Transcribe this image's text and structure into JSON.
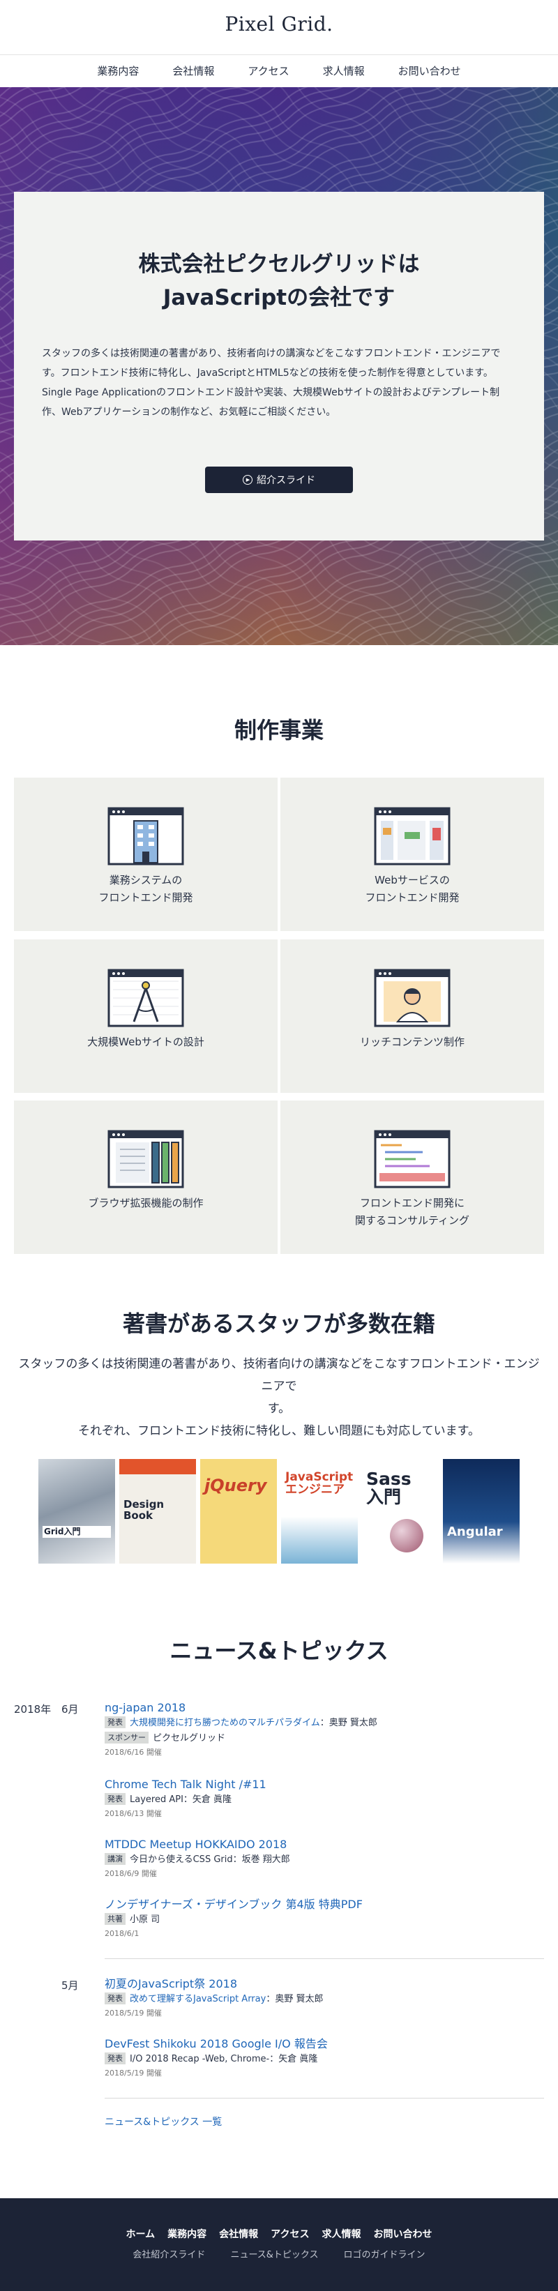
{
  "header": {
    "logo": "Pixel Grid.",
    "nav": [
      "業務内容",
      "会社情報",
      "アクセス",
      "求人情報",
      "お問い合わせ"
    ]
  },
  "hero": {
    "title_line1": "株式会社ピクセルグリッドは",
    "title_line2": "JavaScriptの会社です",
    "lead": "スタッフの多くは技術関連の著書があり、技術者向けの講演などをこなすフロントエンド・エンジニアです。フロントエンド技術に特化し、JavaScriptとHTML5などの技術を使った制作を得意としています。Single Page Applicationのフロントエンド設計や実装、大規模Webサイトの設計およびテンプレート制作、Webアプリケーションの制作など、お気軽にご相談ください。",
    "button_label": "紹介スライド"
  },
  "services": {
    "title": "制作事業",
    "items": [
      {
        "line1": "業務システムの",
        "line2": "フロントエンド開発",
        "icon": "building-window-icon"
      },
      {
        "line1": "Webサービスの",
        "line2": "フロントエンド開発",
        "icon": "webapp-window-icon"
      },
      {
        "line1": "大規模Webサイトの設計",
        "line2": "",
        "icon": "compass-window-icon"
      },
      {
        "line1": "リッチコンテンツ制作",
        "line2": "",
        "icon": "person-window-icon"
      },
      {
        "line1": "ブラウザ拡張機能の制作",
        "line2": "",
        "icon": "binders-window-icon"
      },
      {
        "line1": "フロントエンド開発に",
        "line2": "関するコンサルティング",
        "icon": "code-window-icon"
      }
    ]
  },
  "staff": {
    "title": "著書があるスタッフが多数在籍",
    "lead_line1": "スタッフの多くは技術関連の著書があり、技術者向けの講演などをこなすフロントエンド・エンジニアで",
    "lead_line2": "す。",
    "lead_line3": "それぞれ、フロントエンド技術に特化し、難しい問題にも対応しています。",
    "books": [
      {
        "title": "Grid入門"
      },
      {
        "title": "Design Book"
      },
      {
        "title": "jQuery"
      },
      {
        "title": "JavaScript エンジニア"
      },
      {
        "title": "Sass 入門"
      },
      {
        "title": "Angular"
      }
    ]
  },
  "news": {
    "title": "ニュース&トピックス",
    "year": "2018年",
    "months": [
      "6月",
      "5月"
    ],
    "items": [
      {
        "title": "ng-japan 2018",
        "rows": [
          {
            "tag": "発表",
            "link": "大規模開発に打ち勝つためのマルチパラダイム",
            "text": "：奥野 賢太郎"
          },
          {
            "tag": "スポンサー",
            "link": "",
            "text": "ピクセルグリッド"
          }
        ],
        "date": "2018/6/16 開催"
      },
      {
        "title": "Chrome Tech Talk Night /#11",
        "rows": [
          {
            "tag": "発表",
            "link": "",
            "text": "Layered API：矢倉 眞隆"
          }
        ],
        "date": "2018/6/13 開催"
      },
      {
        "title": "MTDDC Meetup HOKKAIDO 2018",
        "rows": [
          {
            "tag": "講演",
            "link": "",
            "text": "今日から使えるCSS Grid：坂巻 翔大郎"
          }
        ],
        "date": "2018/6/9 開催"
      },
      {
        "title": "ノンデザイナーズ・デザインブック 第4版 特典PDF",
        "rows": [
          {
            "tag": "共著",
            "link": "",
            "text": "小原 司"
          }
        ],
        "date": "2018/6/1"
      },
      {
        "title": "初夏のJavaScript祭 2018",
        "rows": [
          {
            "tag": "発表",
            "link": "改めて理解するJavaScript Array",
            "text": "：奥野 賢太郎"
          }
        ],
        "date": "2018/5/19 開催"
      },
      {
        "title": "DevFest Shikoku 2018 Google I/O 報告会",
        "rows": [
          {
            "tag": "発表",
            "link": "",
            "text": "I/O 2018 Recap -Web, Chrome-：矢倉 眞隆"
          }
        ],
        "date": "2018/5/19 開催"
      }
    ],
    "more": "ニュース&トピックス 一覧"
  },
  "footer": {
    "nav1": [
      "ホーム",
      "業務内容",
      "会社情報",
      "アクセス",
      "求人情報",
      "お問い合わせ"
    ],
    "nav2": [
      "会社紹介スライド",
      "ニュース&トピックス",
      "ロゴのガイドライン"
    ]
  }
}
